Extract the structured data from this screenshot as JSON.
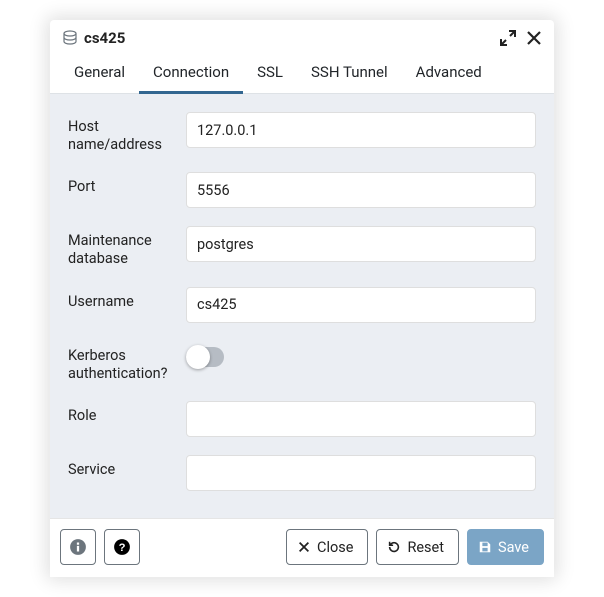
{
  "dialog": {
    "title": "cs425"
  },
  "tabs": {
    "general": "General",
    "connection": "Connection",
    "ssl": "SSL",
    "ssh": "SSH Tunnel",
    "advanced": "Advanced"
  },
  "form": {
    "host_label": "Host name/address",
    "host_value": "127.0.0.1",
    "port_label": "Port",
    "port_value": "5556",
    "maintdb_label": "Maintenance database",
    "maintdb_value": "postgres",
    "username_label": "Username",
    "username_value": "cs425",
    "kerberos_label": "Kerberos authentication?",
    "role_label": "Role",
    "role_value": "",
    "service_label": "Service",
    "service_value": ""
  },
  "footer": {
    "close": "Close",
    "reset": "Reset",
    "save": "Save"
  }
}
